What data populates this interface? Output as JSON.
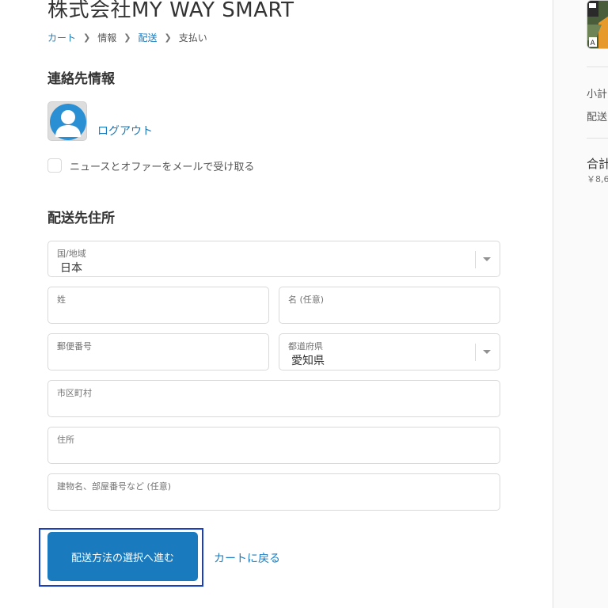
{
  "header": {
    "store_name": "株式会社MY WAY SMART"
  },
  "breadcrumb": {
    "items": [
      {
        "label": "カート",
        "link": true
      },
      {
        "label": "情報",
        "link": false
      },
      {
        "label": "配送",
        "link": true
      },
      {
        "label": "支払い",
        "link": false
      }
    ]
  },
  "contact": {
    "heading": "連絡先情報",
    "logout_label": "ログアウト",
    "newsletter_label": "ニュースとオファーをメールで受け取る",
    "newsletter_checked": false
  },
  "shipping": {
    "heading": "配送先住所",
    "fields": {
      "country": {
        "label": "国/地域",
        "value": "日本"
      },
      "last_name": {
        "label": "姓",
        "value": ""
      },
      "first_name": {
        "label": "名 (任意)",
        "value": ""
      },
      "postal_code": {
        "label": "郵便番号",
        "value": ""
      },
      "prefecture": {
        "label": "都道府県",
        "value": "愛知県"
      },
      "city": {
        "label": "市区町村",
        "value": ""
      },
      "address": {
        "label": "住所",
        "value": ""
      },
      "building": {
        "label": "建物名、部屋番号など (任意)",
        "value": ""
      }
    }
  },
  "actions": {
    "continue_label": "配送方法の選択へ進む",
    "return_label": "カートに戻る"
  },
  "summary": {
    "subtotal_label": "小計",
    "shipping_label": "配送",
    "total_label": "合計",
    "total_amount_partial": "￥8,6",
    "thumb_badge": "A"
  },
  "colors": {
    "accent": "#197bbd",
    "focus_ring": "#1a3fc7",
    "border": "#d9d9d9"
  }
}
